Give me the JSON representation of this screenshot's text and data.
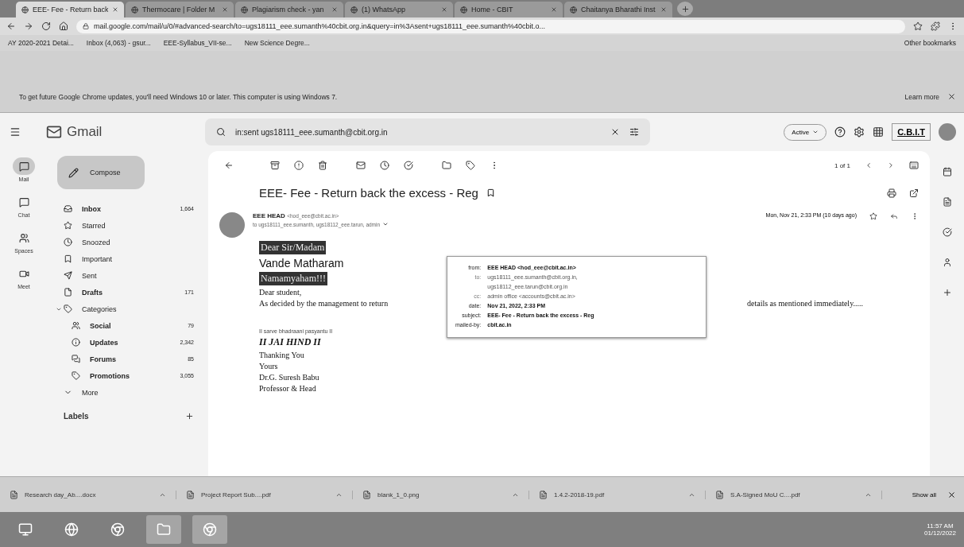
{
  "browser": {
    "tabs": [
      {
        "title": "EEE- Fee - Return back",
        "selected": true
      },
      {
        "title": "Thermocare | Folder M",
        "selected": false
      },
      {
        "title": "Plagiarism check - yan",
        "selected": false
      },
      {
        "title": "(1) WhatsApp",
        "selected": false
      },
      {
        "title": "Home - CBIT",
        "selected": false
      },
      {
        "title": "Chaitanya Bharathi Inst",
        "selected": false
      }
    ],
    "url": "mail.google.com/mail/u/0/#advanced-search/to=ugs18111_eee.sumanth%40cbit.org.in&query=in%3Asent+ugs18111_eee.sumanth%40cbit.o...",
    "bookmarks": [
      "AY 2020-2021 Detai...",
      "Inbox (4,063) - gsur...",
      "EEE-Syllabus_VII-se...",
      "New Science Degre..."
    ],
    "other_bookmarks": "Other bookmarks",
    "infobar": {
      "message": "To get future Google Chrome updates, you'll need Windows 10 or later. This computer is using Windows 7.",
      "link": "Learn more"
    }
  },
  "gmail": {
    "logo": "Gmail",
    "search": "in:sent ugs18111_eee.sumanth@cbit.org.in",
    "status": "Active",
    "org": "C.B.I.T",
    "rail": [
      {
        "label": "Mail",
        "selected": true
      },
      {
        "label": "Chat",
        "selected": false
      },
      {
        "label": "Spaces",
        "selected": false
      },
      {
        "label": "Meet",
        "selected": false
      }
    ],
    "compose": "Compose",
    "nav": [
      {
        "label": "Inbox",
        "count": "1,664",
        "bold": true
      },
      {
        "label": "Starred",
        "bold": false
      },
      {
        "label": "Snoozed",
        "bold": false
      },
      {
        "label": "Important",
        "bold": false
      },
      {
        "label": "Sent",
        "bold": false
      },
      {
        "label": "Drafts",
        "count": "171",
        "bold": true
      },
      {
        "label": "Categories",
        "bold": false,
        "expanded": true,
        "children": [
          {
            "label": "Social",
            "count": "79",
            "bold": true
          },
          {
            "label": "Updates",
            "count": "2,342",
            "bold": true
          },
          {
            "label": "Forums",
            "count": "85",
            "bold": true
          },
          {
            "label": "Promotions",
            "count": "3,055",
            "bold": true
          }
        ]
      },
      {
        "label": "More",
        "bold": false
      }
    ],
    "labels": "Labels",
    "pager": "1 of 1",
    "subject": "EEE- Fee - Return back the excess - Reg",
    "sender": {
      "name": "EEE HEAD",
      "address": "<hod_eee@cbit.ac.in>",
      "recipients": "to ugs18111_eee.sumanth, ugs18112_eee.tarun, admin",
      "date": "Mon, Nov 21, 2:33 PM (10 days ago)"
    },
    "body": [
      {
        "kind": "highlight",
        "text": "Dear Sir/Madam"
      },
      {
        "kind": "heading",
        "text": "Vande Matharam"
      },
      {
        "kind": "highlight",
        "text": "Namamyaham!!!"
      },
      {
        "kind": "serif",
        "text": "Dear student,"
      },
      {
        "kind": "split",
        "text": "As decided by the management to return",
        "tail": "details as mentioned immediately....."
      },
      {
        "kind": "gap"
      },
      {
        "kind": "small",
        "text": "II sarve bhadraani pasyantu II"
      },
      {
        "kind": "motto",
        "text": "II JAI HIND II"
      },
      {
        "kind": "serif",
        "text": "Thanking You"
      },
      {
        "kind": "serif",
        "text": "Yours"
      },
      {
        "kind": "serif",
        "text": "Dr.G. Suresh Babu"
      },
      {
        "kind": "serif",
        "text": "Professor & Head"
      }
    ],
    "details": [
      {
        "label": "from:",
        "value": "EEE HEAD <hod_eee@cbit.ac.in>",
        "strong": true
      },
      {
        "label": "to:",
        "value": "ugs18111_eee.sumanth@cbit.org.in,",
        "strong": false
      },
      {
        "value": "ugs18112_eee.tarun@cbit.org.in",
        "strong": false
      },
      {
        "label": "cc:",
        "value": "admin office <accounts@cbit.ac.in>",
        "strong": false
      },
      {
        "label": "date:",
        "value": "Nov 21, 2022, 2:33 PM",
        "strong": true
      },
      {
        "label": "subject:",
        "value": "EEE- Fee - Return back the excess - Reg",
        "strong": true
      },
      {
        "label": "mailed-by:",
        "value": "cbit.ac.in",
        "strong": true
      }
    ]
  },
  "downloads": {
    "files": [
      "Research day_Ab....docx",
      "Project Report Sub....pdf",
      "blank_1_0.png",
      "1.4.2-2018-19.pdf",
      "S.A-Signed MoU C....pdf"
    ],
    "show_all": "Show all"
  },
  "taskbar": {
    "time": "11:57 AM",
    "date": "01/12/2022"
  }
}
